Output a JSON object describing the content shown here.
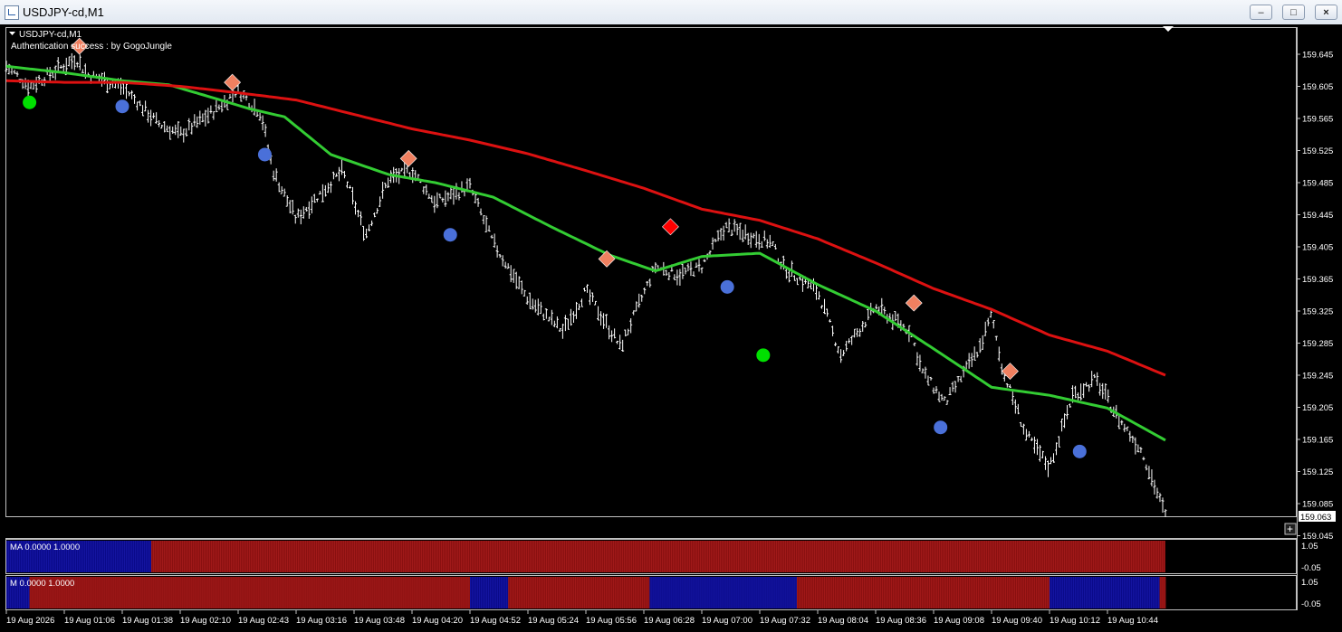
{
  "window": {
    "title": "USDJPY-cd,M1",
    "buttons": [
      "minimize",
      "maximize",
      "close"
    ]
  },
  "chart": {
    "symbol_label": "USDJPY-cd,M1",
    "auth_text": "Authentication success : by GogoJungle",
    "current_price": "159.063",
    "colors": {
      "background": "#000000",
      "bars": "#ffffff",
      "ma_fast": "#33cc33",
      "ma_slow": "#dd1111",
      "buy_dot": "#00e000",
      "sell_dot": "#4a70d9",
      "diamond": "#f08060",
      "diamond_red": "#ff0000",
      "strip_blue": "#0a0a8a",
      "strip_red": "#8a1010"
    },
    "y_ticks": [
      "159.645",
      "159.605",
      "159.565",
      "159.525",
      "159.485",
      "159.445",
      "159.405",
      "159.365",
      "159.325",
      "159.285",
      "159.245",
      "159.205",
      "159.165",
      "159.125",
      "159.085",
      "159.045"
    ],
    "x_ticks": [
      "19 Aug 2026",
      "19 Aug 01:06",
      "19 Aug 01:38",
      "19 Aug 02:10",
      "19 Aug 02:43",
      "19 Aug 03:16",
      "19 Aug 03:48",
      "19 Aug 04:20",
      "19 Aug 04:52",
      "19 Aug 05:24",
      "19 Aug 05:56",
      "19 Aug 06:28",
      "19 Aug 07:00",
      "19 Aug 07:32",
      "19 Aug 08:04",
      "19 Aug 08:36",
      "19 Aug 09:08",
      "19 Aug 09:40",
      "19 Aug 10:12",
      "19 Aug 10:44"
    ]
  },
  "indicator1": {
    "label": "MA 0.0000 1.0000",
    "y_top": "1.05",
    "y_bottom": "-0.05",
    "segments": [
      {
        "from": 0.0,
        "to": 0.125,
        "color": "blue"
      },
      {
        "from": 0.125,
        "to": 1.0,
        "color": "red"
      }
    ]
  },
  "indicator2": {
    "label": "M 0.0000 1.0000",
    "y_top": "1.05",
    "y_bottom": "-0.05",
    "segments": [
      {
        "from": 0.0,
        "to": 0.02,
        "color": "blue"
      },
      {
        "from": 0.02,
        "to": 0.4,
        "color": "red"
      },
      {
        "from": 0.4,
        "to": 0.433,
        "color": "blue"
      },
      {
        "from": 0.433,
        "to": 0.555,
        "color": "red"
      },
      {
        "from": 0.555,
        "to": 0.682,
        "color": "blue"
      },
      {
        "from": 0.682,
        "to": 0.9,
        "color": "red"
      },
      {
        "from": 0.9,
        "to": 0.995,
        "color": "blue"
      },
      {
        "from": 0.995,
        "to": 1.0,
        "color": "red"
      }
    ]
  },
  "chart_data": {
    "type": "line",
    "title": "USDJPY-cd,M1",
    "xlabel": "",
    "ylabel": "",
    "ylim": [
      159.045,
      159.665
    ],
    "grid": false,
    "price_path": {
      "t": [
        0,
        0.02,
        0.06,
        0.07,
        0.1,
        0.13,
        0.15,
        0.18,
        0.2,
        0.22,
        0.23,
        0.25,
        0.27,
        0.29,
        0.31,
        0.33,
        0.35,
        0.37,
        0.4,
        0.42,
        0.45,
        0.48,
        0.5,
        0.53,
        0.56,
        0.58,
        0.6,
        0.62,
        0.64,
        0.66,
        0.67,
        0.7,
        0.72,
        0.75,
        0.78,
        0.79,
        0.81,
        0.84,
        0.85,
        0.86,
        0.88,
        0.9,
        0.92,
        0.94,
        0.96,
        0.98,
        1.0
      ],
      "price": [
        159.63,
        159.605,
        159.64,
        159.62,
        159.605,
        159.56,
        159.545,
        159.575,
        159.6,
        159.57,
        159.5,
        159.44,
        159.47,
        159.5,
        159.42,
        159.49,
        159.5,
        159.46,
        159.48,
        159.41,
        159.34,
        159.3,
        159.35,
        159.28,
        159.38,
        159.37,
        159.38,
        159.43,
        159.42,
        159.41,
        159.38,
        159.35,
        159.27,
        159.33,
        159.3,
        159.25,
        159.21,
        159.28,
        159.32,
        159.25,
        159.17,
        159.13,
        159.22,
        159.24,
        159.19,
        159.15,
        159.07
      ]
    },
    "series": [
      {
        "name": "",
        "t": [
          0,
          0.05,
          0.1,
          0.14,
          0.18,
          0.21,
          0.24,
          0.28,
          0.33,
          0.37,
          0.42,
          0.47,
          0.52,
          0.56,
          0.6,
          0.65,
          0.7,
          0.75,
          0.8,
          0.85,
          0.9,
          0.95,
          1.0
        ],
        "values": [
          159.63,
          159.622,
          159.612,
          159.607,
          159.59,
          159.577,
          159.567,
          159.52,
          159.495,
          159.485,
          159.467,
          159.43,
          159.395,
          159.375,
          159.393,
          159.397,
          159.358,
          159.325,
          159.278,
          159.23,
          159.22,
          159.204,
          159.164
        ]
      },
      {
        "name": "",
        "t": [
          0,
          0.05,
          0.1,
          0.15,
          0.2,
          0.25,
          0.3,
          0.35,
          0.4,
          0.45,
          0.5,
          0.55,
          0.6,
          0.65,
          0.7,
          0.75,
          0.8,
          0.85,
          0.9,
          0.95,
          1.0
        ],
        "values": [
          159.612,
          159.61,
          159.61,
          159.605,
          159.597,
          159.588,
          159.57,
          159.552,
          159.538,
          159.521,
          159.5,
          159.478,
          159.452,
          159.438,
          159.415,
          159.385,
          159.353,
          159.327,
          159.295,
          159.275,
          159.245
        ]
      }
    ],
    "markers": [
      {
        "type": "buy-dot",
        "t": 0.02,
        "price": 159.585
      },
      {
        "type": "sell-dot",
        "t": 0.1,
        "price": 159.58
      },
      {
        "type": "sell-dot",
        "t": 0.223,
        "price": 159.52
      },
      {
        "type": "sell-dot",
        "t": 0.383,
        "price": 159.42
      },
      {
        "type": "sell-dot",
        "t": 0.622,
        "price": 159.355
      },
      {
        "type": "buy-dot",
        "t": 0.653,
        "price": 159.27
      },
      {
        "type": "sell-dot",
        "t": 0.806,
        "price": 159.18
      },
      {
        "type": "sell-dot",
        "t": 0.926,
        "price": 159.15
      },
      {
        "type": "diamond",
        "t": 0.063,
        "price": 159.655
      },
      {
        "type": "diamond",
        "t": 0.195,
        "price": 159.61
      },
      {
        "type": "diamond",
        "t": 0.347,
        "price": 159.515
      },
      {
        "type": "diamond",
        "t": 0.518,
        "price": 159.39
      },
      {
        "type": "diamond-red",
        "t": 0.573,
        "price": 159.43
      },
      {
        "type": "diamond",
        "t": 0.783,
        "price": 159.335
      },
      {
        "type": "diamond",
        "t": 0.866,
        "price": 159.25
      }
    ]
  }
}
